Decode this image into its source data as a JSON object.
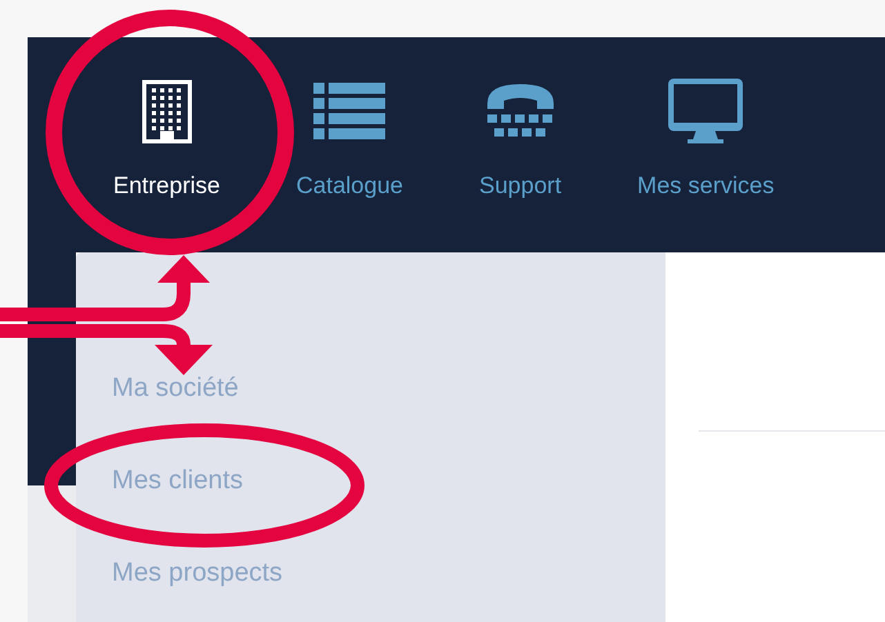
{
  "nav": [
    {
      "label": "Entreprise",
      "selected": true,
      "kind": "building"
    },
    {
      "label": "Catalogue",
      "selected": false,
      "kind": "list"
    },
    {
      "label": "Support",
      "selected": false,
      "kind": "phone"
    },
    {
      "label": "Mes services",
      "selected": false,
      "kind": "monitor"
    }
  ],
  "menu": {
    "items": [
      "Ma société",
      "Mes clients",
      "Mes prospects"
    ]
  }
}
